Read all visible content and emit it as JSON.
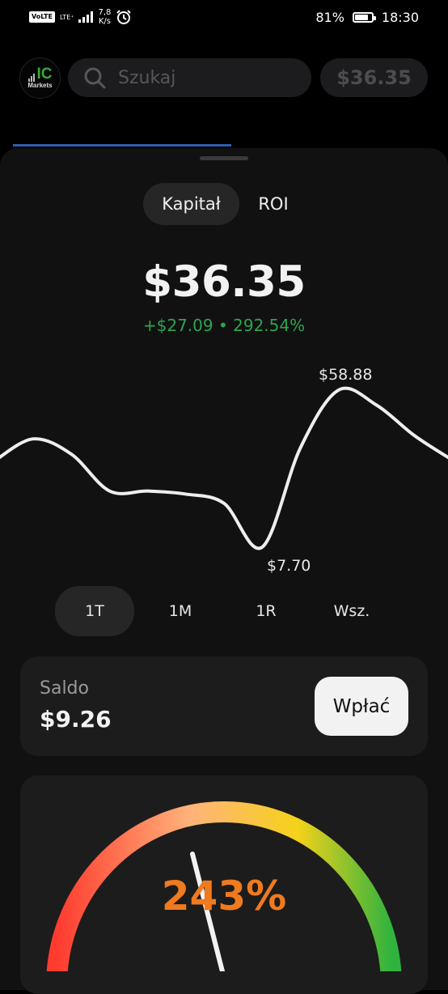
{
  "status_bar": {
    "volte": "VoLTE",
    "network": "LTE⁺",
    "speed_value": "7,8",
    "speed_unit": "K/s",
    "alarm_icon": "alarm-clock-icon",
    "battery_percent": "81%",
    "battery_level": 0.81,
    "time": "18:30"
  },
  "header": {
    "logo_text_top": "IC",
    "logo_text_bottom": "Markets",
    "search_placeholder": "Szukaj",
    "balance": "$36.35"
  },
  "sheet": {
    "tabs": [
      {
        "label": "Kapitał",
        "active": true
      },
      {
        "label": "ROI",
        "active": false
      }
    ],
    "equity_value": "$36.35",
    "change_text": "+$27.09 • 292.54%",
    "change_color": "#2ea44f"
  },
  "chart_data": {
    "type": "line",
    "max_label": "$58.88",
    "min_label": "$7.70",
    "x": [
      0,
      1,
      2,
      3,
      4,
      5,
      6,
      7,
      8,
      9,
      10,
      11,
      12
    ],
    "values": [
      36,
      43,
      38,
      26,
      26,
      25,
      22,
      7.7,
      40,
      58.88,
      54,
      44,
      36
    ],
    "ylim": [
      7.7,
      58.88
    ],
    "grid": false
  },
  "ranges": [
    {
      "label": "1T",
      "active": true
    },
    {
      "label": "1M",
      "active": false
    },
    {
      "label": "1R",
      "active": false
    },
    {
      "label": "Wsz.",
      "active": false
    }
  ],
  "saldo": {
    "label": "Saldo",
    "value": "$9.26",
    "deposit_label": "Wpłać"
  },
  "roi_gauge": {
    "value_text": "243%",
    "value": 243,
    "value_color": "#f07a1e",
    "gradient_colors": [
      "#ff3b2f",
      "#ffb37a",
      "#f5d21a",
      "#2fb33e"
    ]
  }
}
